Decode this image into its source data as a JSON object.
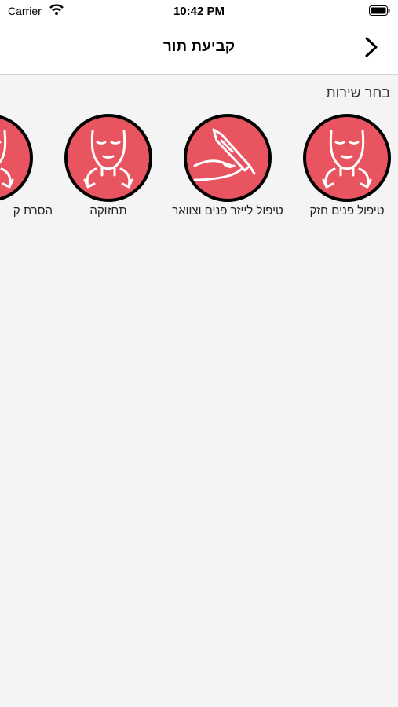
{
  "status_bar": {
    "carrier": "Carrier",
    "time": "10:42 PM"
  },
  "nav": {
    "title": "קביעת תור"
  },
  "section_label": "בחר שירות",
  "services": [
    {
      "label": "טיפול פנים חזק",
      "icon": "face-lift-icon"
    },
    {
      "label": "טיפול לייזר פנים וצוואר",
      "icon": "laser-pen-icon"
    },
    {
      "label": "תחזוקה",
      "icon": "face-lift-icon"
    },
    {
      "label": "הסרת ק",
      "icon": "face-lift-icon"
    }
  ],
  "colors": {
    "accent": "#e8545f",
    "background": "#f4f4f4"
  }
}
